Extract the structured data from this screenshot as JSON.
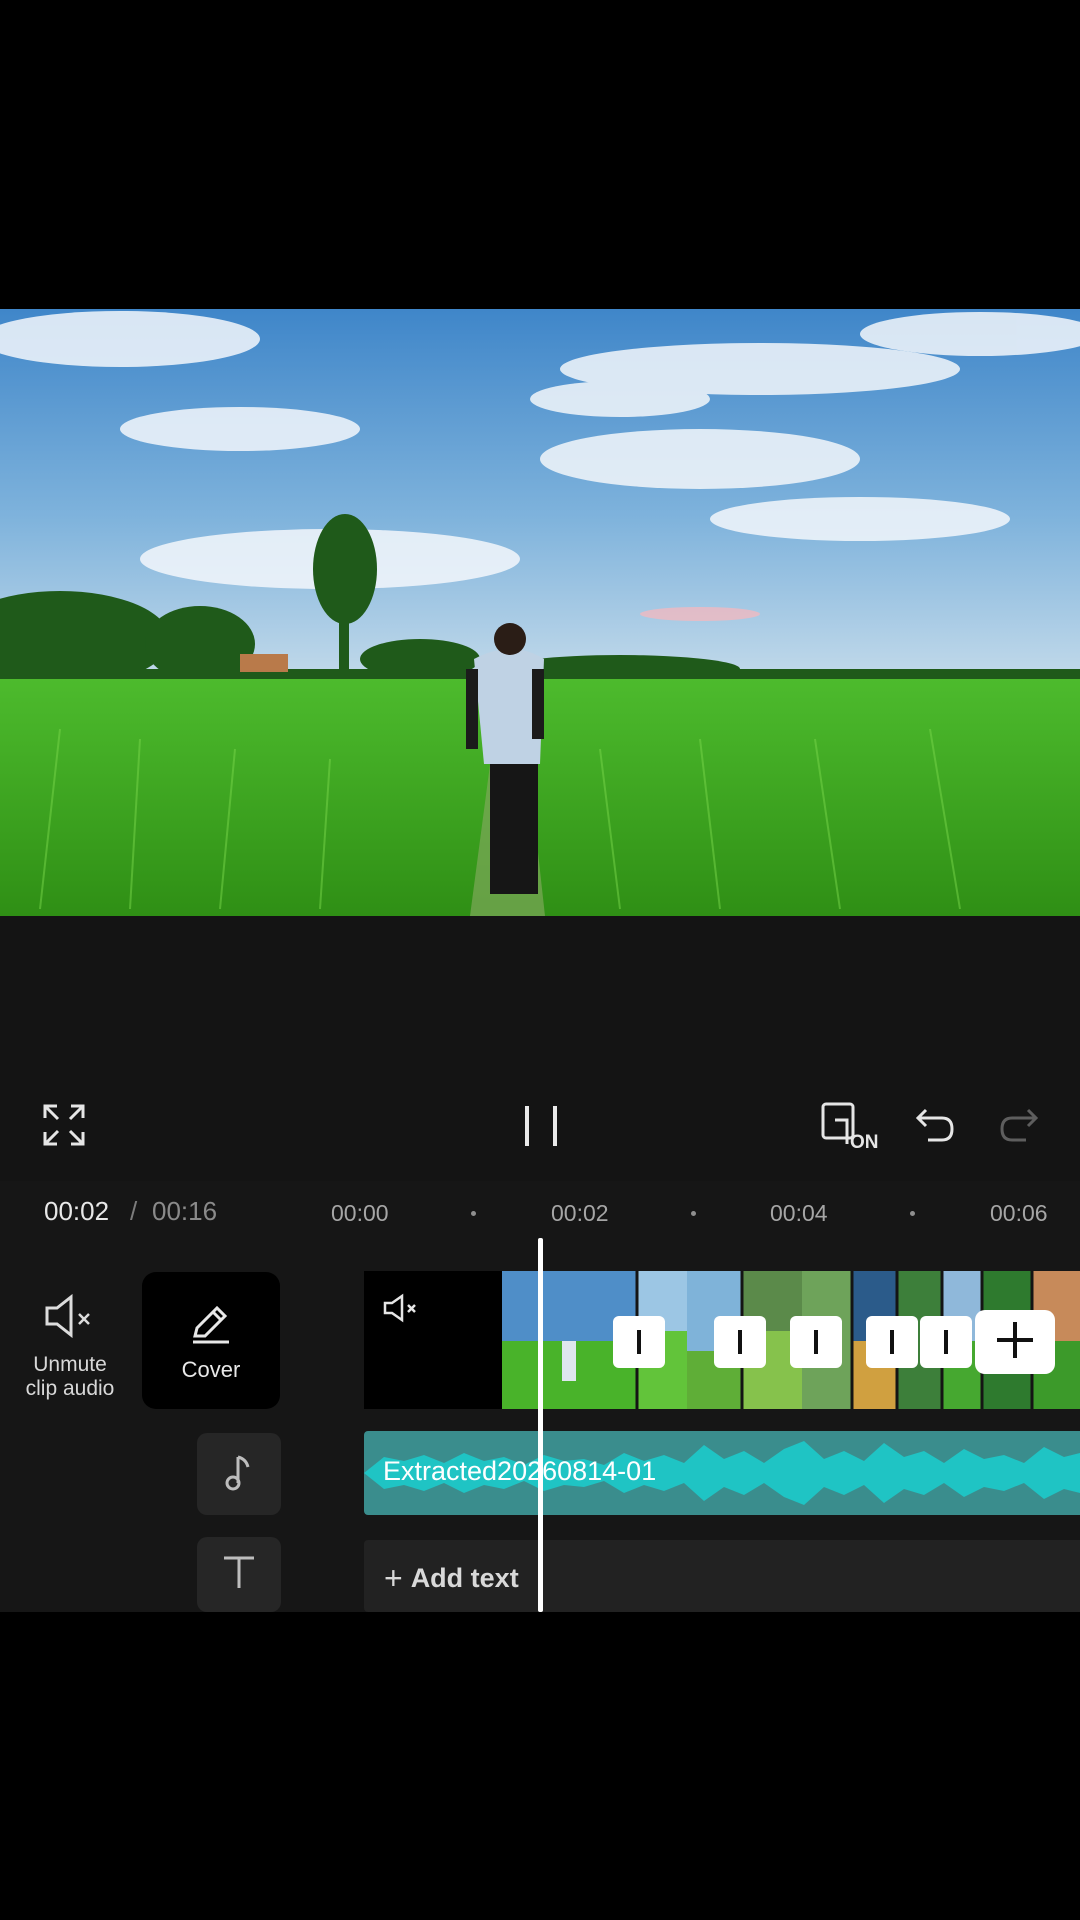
{
  "player": {
    "current_time": "00:02",
    "separator": "/",
    "total_time": "00:16",
    "sync_badge": "ON"
  },
  "ruler": {
    "labels": [
      "00:00",
      "00:02",
      "00:04",
      "00:06"
    ]
  },
  "tools": {
    "unmute_label_line1": "Unmute",
    "unmute_label_line2": "clip audio",
    "cover_label": "Cover"
  },
  "tracks": {
    "audio_clip_name": "Extracted20260814-01",
    "add_text_label": "Add text"
  },
  "colors": {
    "audio_track": "#3a8d8d",
    "waveform": "#1fc4c4",
    "editor_bg": "#141414"
  },
  "icons": [
    "fullscreen-icon",
    "pause-icon",
    "sync-on-icon",
    "undo-icon",
    "redo-icon",
    "mute-icon",
    "pencil-icon",
    "music-note-icon",
    "text-icon",
    "plus-icon"
  ]
}
